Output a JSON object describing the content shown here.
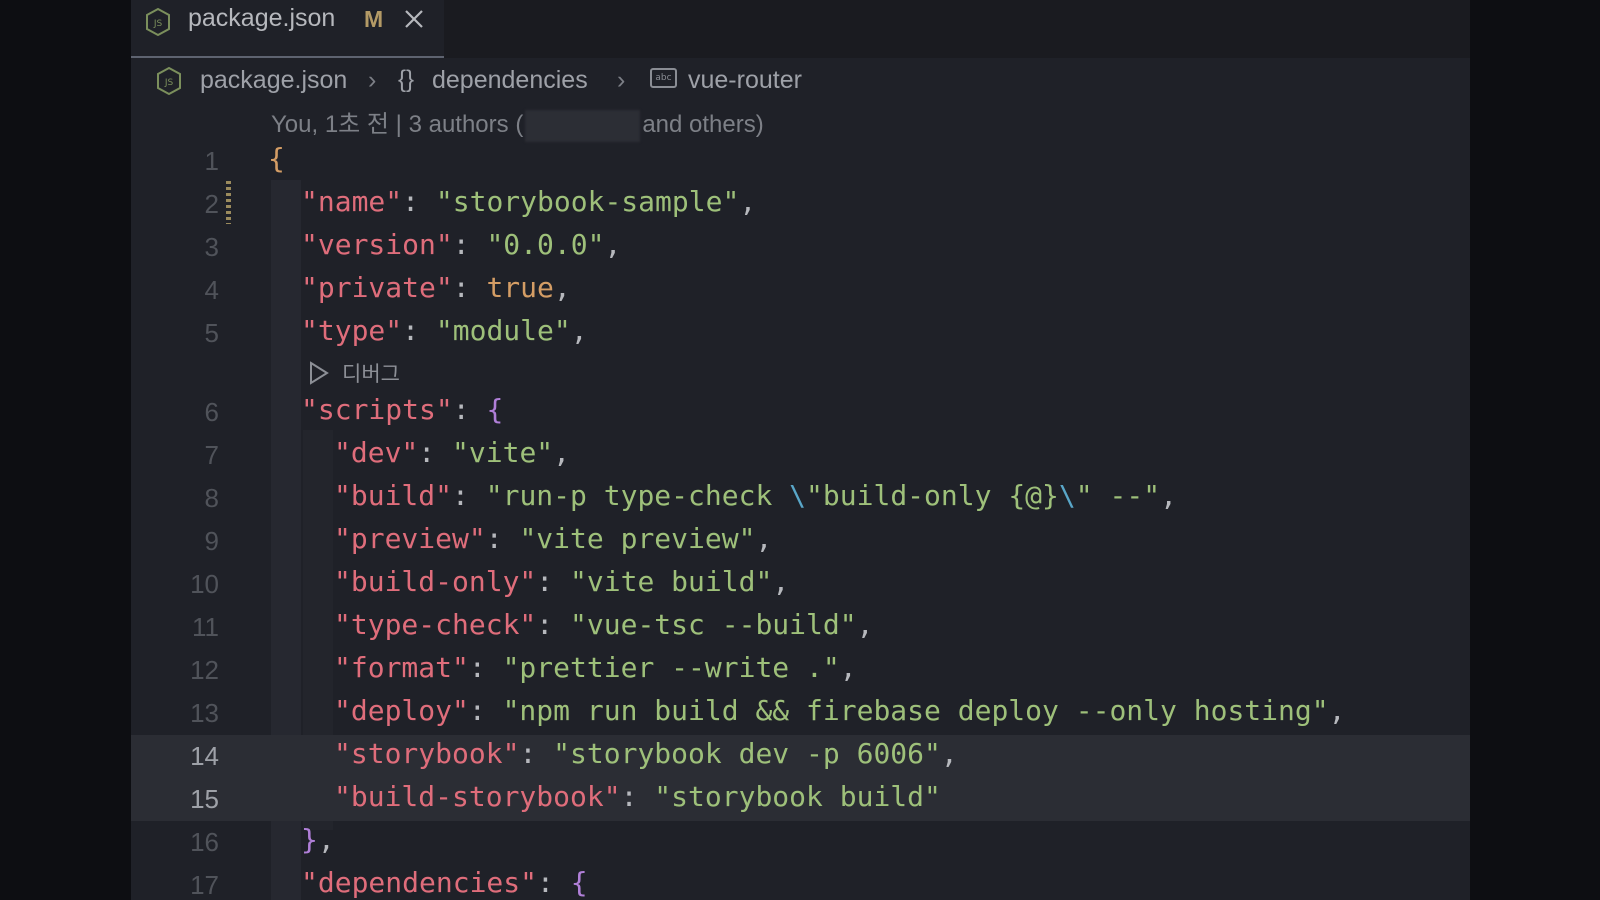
{
  "tab": {
    "label": "package.json",
    "modified": "M"
  },
  "breadcrumb": {
    "file": "package.json",
    "braces": "{}",
    "section": "dependencies",
    "item": "vue-router",
    "item_icon": "abc"
  },
  "blame": {
    "prefix": "You, 1초 전 | 3 authors (",
    "suffix": "and others)"
  },
  "codelens": {
    "label": "디버그"
  },
  "lines": [
    {
      "n": "1"
    },
    {
      "n": "2"
    },
    {
      "n": "3"
    },
    {
      "n": "4"
    },
    {
      "n": "5"
    },
    {
      "n": "6"
    },
    {
      "n": "7"
    },
    {
      "n": "8"
    },
    {
      "n": "9"
    },
    {
      "n": "10"
    },
    {
      "n": "11"
    },
    {
      "n": "12"
    },
    {
      "n": "13"
    },
    {
      "n": "14"
    },
    {
      "n": "15"
    },
    {
      "n": "16"
    },
    {
      "n": "17"
    }
  ],
  "code": {
    "name_key": "\"name\"",
    "name_val": "\"storybook-sample\"",
    "version_key": "\"version\"",
    "version_val": "\"0.0.0\"",
    "private_key": "\"private\"",
    "private_val": "true",
    "type_key": "\"type\"",
    "type_val": "\"module\"",
    "scripts_key": "\"scripts\"",
    "dev_key": "\"dev\"",
    "dev_val": "\"vite\"",
    "build_key": "\"build\"",
    "build_val_a": "\"run-p type-check ",
    "build_esc1": "\\",
    "build_val_b": "\"build-only {@}",
    "build_esc2": "\\",
    "build_val_c": "\" --\"",
    "preview_key": "\"preview\"",
    "preview_val": "\"vite preview\"",
    "buildonly_key": "\"build-only\"",
    "buildonly_val": "\"vite build\"",
    "typecheck_key": "\"type-check\"",
    "typecheck_val": "\"vue-tsc --build\"",
    "format_key": "\"format\"",
    "format_val": "\"prettier --write .\"",
    "deploy_key": "\"deploy\"",
    "deploy_val": "\"npm run build && firebase deploy --only hosting\"",
    "storybook_key": "\"storybook\"",
    "storybook_val": "\"storybook dev -p 6006\"",
    "buildsb_key": "\"build-storybook\"",
    "buildsb_val": "\"storybook build\"",
    "deps_key": "\"dependencies\""
  }
}
